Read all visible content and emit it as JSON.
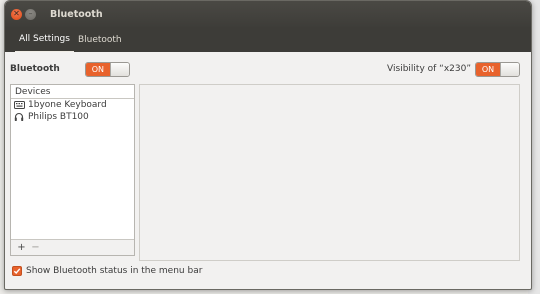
{
  "window": {
    "title": "Bluetooth"
  },
  "toolbar": {
    "crumbs": [
      "All Settings",
      "Bluetooth"
    ]
  },
  "bluetooth": {
    "label": "Bluetooth",
    "toggle": "ON"
  },
  "visibility": {
    "label": "Visibility of “x230”",
    "toggle": "ON"
  },
  "devices": {
    "header": "Devices",
    "items": [
      {
        "name": "1byone Keyboard",
        "icon": "keyboard-icon"
      },
      {
        "name": "Philips BT100",
        "icon": "headset-icon"
      }
    ],
    "add": "+",
    "remove": "−"
  },
  "status": {
    "label": "Show Bluetooth status in the menu bar",
    "checked": true
  },
  "colors": {
    "accent": "#e8622c",
    "titlebar": "#3e3d39",
    "close": "#dd4814"
  }
}
